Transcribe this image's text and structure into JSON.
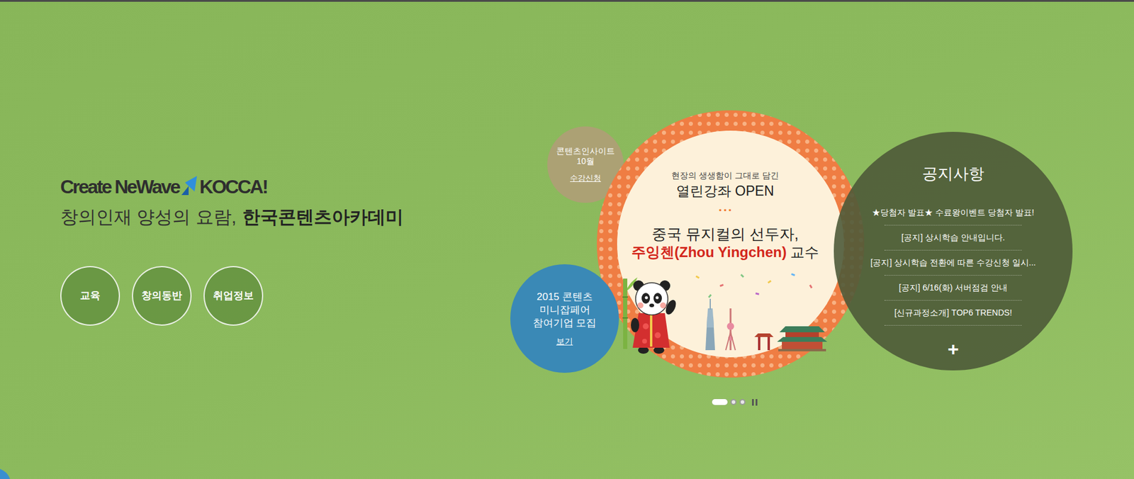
{
  "brand": {
    "logo_left": "Create NeWave",
    "logo_right": "KOCCA!",
    "tagline": "창의인재 양성의 요람,",
    "tagline_bold": "한국콘텐츠아카데미"
  },
  "nav": [
    {
      "label": "교육"
    },
    {
      "label": "창의동반"
    },
    {
      "label": "취업정보"
    }
  ],
  "promo_small": {
    "lines": [
      "콘텐츠인사이트",
      "10월"
    ],
    "link": "수강신청"
  },
  "promo_blue": {
    "lines": [
      "2015 콘텐츠",
      "미니잡페어",
      "참여기업 모집"
    ],
    "link": "보기"
  },
  "feature": {
    "subtitle": "현장의 생생함이 그대로 담긴",
    "title": "열린강좌 OPEN",
    "dots": "• • •",
    "headline": "중국 뮤지컬의 선두자,",
    "name": "주잉첸(Zhou Yingchen)",
    "suffix": "교수"
  },
  "notices": {
    "title": "공지사항",
    "items": [
      "★당첨자 발표★ 수료왕이벤트 당첨자 발표!",
      "[공지] 상시학습 안내입니다.",
      "[공지] 상시학습 전환에 따른 수강신청 일시...",
      "[공지] 6/16(화) 서버점검 안내",
      "[신규과정소개] TOP6 TRENDS!"
    ],
    "more": "+"
  },
  "carousel": {
    "slides": [
      {
        "selected": true
      },
      {
        "selected": false
      },
      {
        "selected": false
      }
    ],
    "playing": true
  }
}
